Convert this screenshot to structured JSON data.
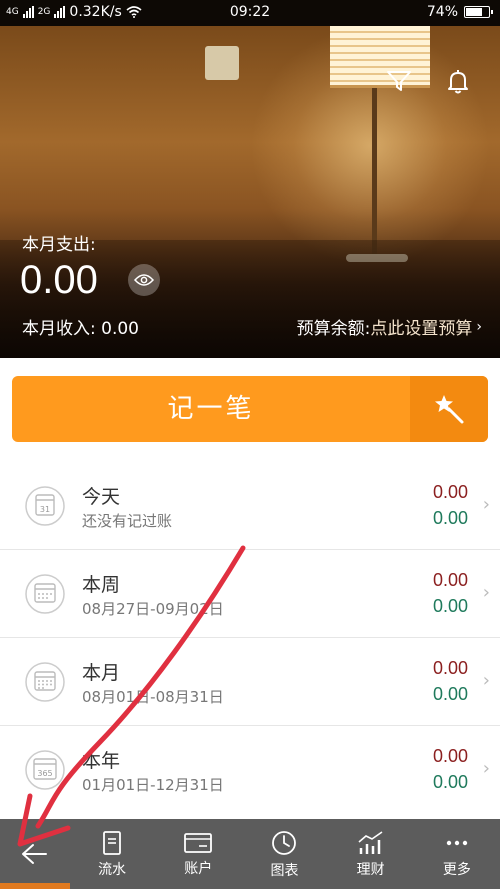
{
  "status_bar": {
    "net_left": "4G",
    "net_right": "2G",
    "speed": "0.32K/s",
    "time": "09:22",
    "battery": "74%",
    "battery_level": 0.74
  },
  "header": {
    "expense_label": "本月支出:",
    "expense_value": "0.00",
    "income_label": "本月收入:",
    "income_value": "0.00",
    "budget_label": "预算余额:",
    "budget_link": "点此设置预算"
  },
  "record_button": {
    "label": "记一笔"
  },
  "periods": [
    {
      "title": "今天",
      "sub": "还没有记过账",
      "expense": "0.00",
      "income": "0.00",
      "icon_text": "31"
    },
    {
      "title": "本周",
      "sub": "08月27日-09月02日",
      "expense": "0.00",
      "income": "0.00",
      "icon_text": ""
    },
    {
      "title": "本月",
      "sub": "08月01日-08月31日",
      "expense": "0.00",
      "income": "0.00",
      "icon_text": ""
    },
    {
      "title": "本年",
      "sub": "01月01日-12月31日",
      "expense": "0.00",
      "income": "0.00",
      "icon_text": "365"
    }
  ],
  "nav": {
    "items": [
      {
        "label": "流水"
      },
      {
        "label": "账户"
      },
      {
        "label": "图表"
      },
      {
        "label": "理财"
      },
      {
        "label": "更多"
      }
    ]
  },
  "colors": {
    "accent": "#ff9a1e",
    "expense": "#8b1f1f",
    "income": "#1f7a5c",
    "nav_bg": "#5c5c5c",
    "annotation": "#e03040"
  },
  "icons": [
    "filter-icon",
    "bell-icon",
    "eye-icon",
    "magic-wand-icon",
    "calendar-icon",
    "back-arrow-icon",
    "list-icon",
    "card-icon",
    "clock-chart-icon",
    "growth-chart-icon"
  ]
}
